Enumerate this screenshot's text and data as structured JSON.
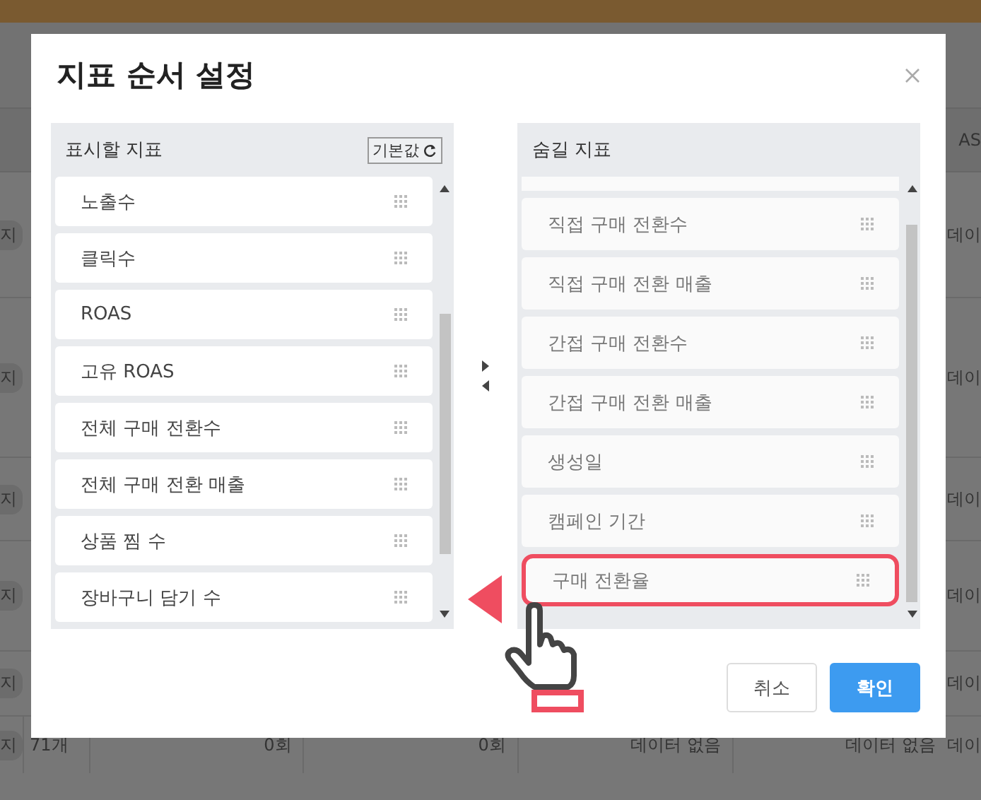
{
  "background": {
    "header_fragment": "AS",
    "rows": [
      {
        "left": "지",
        "right": "데이"
      },
      {
        "left": "지",
        "right": "데이"
      },
      {
        "left": "지",
        "right": "데이"
      },
      {
        "left": "지",
        "right": "데이"
      },
      {
        "left": "지",
        "right": "데이"
      }
    ],
    "last_row": {
      "left": "지",
      "cells": [
        "71개",
        "0회",
        "0회",
        "데이터 없음",
        "데이터 없음"
      ],
      "right": "데이"
    }
  },
  "dialog": {
    "title": "지표 순서 설정",
    "visible_panel": {
      "title": "표시할 지표",
      "reset_button": "기본값",
      "items": [
        {
          "label": "노출수",
          "selected": false
        },
        {
          "label": "클릭수",
          "selected": false
        },
        {
          "label": "ROAS",
          "selected": false
        },
        {
          "label": "고유 ROAS",
          "selected": false
        },
        {
          "label": "전체 구매 전환수",
          "selected": false
        },
        {
          "label": "전체 구매 전환 매출",
          "selected": false
        },
        {
          "label": "상품 찜 수",
          "selected": false
        },
        {
          "label": "장바구니 담기 수",
          "selected": false
        }
      ]
    },
    "hidden_panel": {
      "title": "숨길 지표",
      "items": [
        {
          "label": "직접 구매 전환수",
          "selected": false
        },
        {
          "label": "직접 구매 전환 매출",
          "selected": false
        },
        {
          "label": "간접 구매 전환수",
          "selected": false
        },
        {
          "label": "간접 구매 전환 매출",
          "selected": false
        },
        {
          "label": "생성일",
          "selected": false
        },
        {
          "label": "캠페인 기간",
          "selected": false
        },
        {
          "label": "구매 전환율",
          "selected": true
        }
      ]
    },
    "buttons": [
      {
        "label": "취소",
        "kind": "secondary"
      },
      {
        "label": "확인",
        "kind": "primary"
      }
    ]
  }
}
